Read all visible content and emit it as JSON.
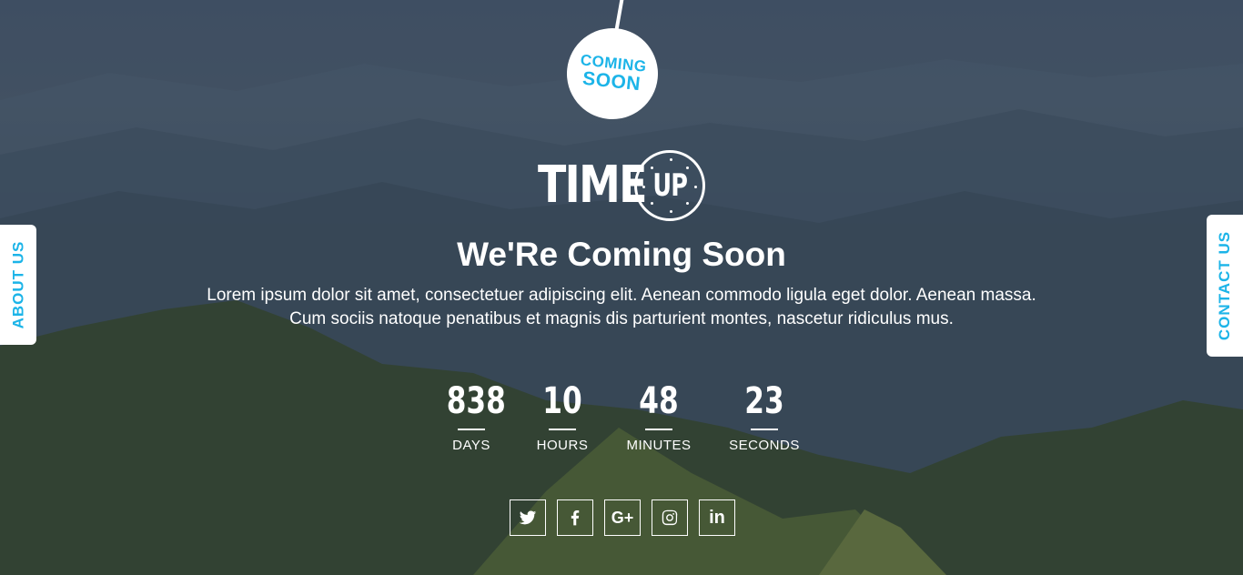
{
  "badge": {
    "line1": "COMING",
    "line2": "SOON"
  },
  "logo": {
    "word": "TIME",
    "circle_word": "UP"
  },
  "headline": "We'Re Coming Soon",
  "description": "Lorem ipsum dolor sit amet, consectetuer adipiscing elit. Aenean commodo ligula eget dolor. Aenean massa. Cum sociis natoque penatibus et magnis dis parturient montes, nascetur ridiculus mus.",
  "countdown": {
    "days": {
      "value": "838",
      "label": "DAYS"
    },
    "hours": {
      "value": "10",
      "label": "HOURS"
    },
    "minutes": {
      "value": "48",
      "label": "MINUTES"
    },
    "seconds": {
      "value": "23",
      "label": "SECONDS"
    }
  },
  "side_tabs": {
    "left": "ABOUT US",
    "right": "CONTACT US"
  },
  "socials": [
    {
      "icon": "twitter-icon"
    },
    {
      "icon": "facebook-icon"
    },
    {
      "icon": "google-plus-icon",
      "text": "G+"
    },
    {
      "icon": "instagram-icon"
    },
    {
      "icon": "linkedin-icon",
      "text": "in"
    }
  ],
  "colors": {
    "accent": "#1cb4e8",
    "text": "#ffffff"
  }
}
